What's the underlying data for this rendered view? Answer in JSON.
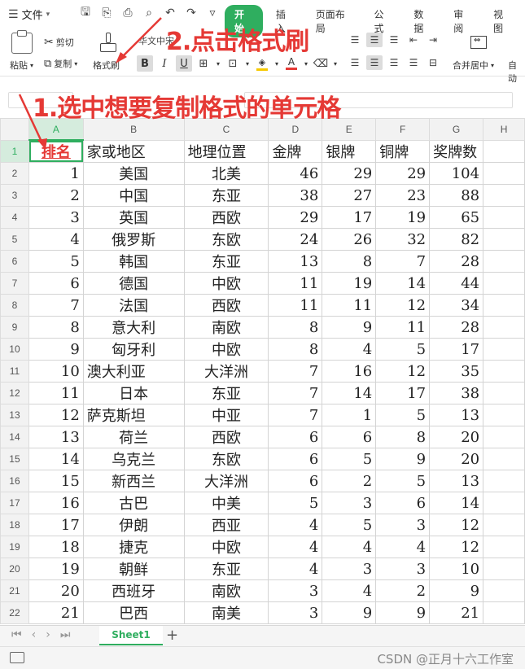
{
  "menubar": {
    "file_label": "文件",
    "tabs": [
      {
        "label": "开始",
        "active": true
      },
      {
        "label": "插入",
        "active": false
      },
      {
        "label": "页面布局",
        "active": false
      },
      {
        "label": "公式",
        "active": false
      },
      {
        "label": "数据",
        "active": false
      },
      {
        "label": "审阅",
        "active": false
      },
      {
        "label": "视图",
        "active": false
      }
    ]
  },
  "ribbon": {
    "paste_label": "粘贴",
    "cut_label": "剪切",
    "copy_label": "复制",
    "format_painter_label": "格式刷",
    "font_name": "华文中宋",
    "merge_label": "合并居中",
    "autowrap_label": "自动"
  },
  "annotations": {
    "step1": "1.选中想要复制格式的单元格",
    "step2": "2.点击格式刷"
  },
  "sheet": {
    "columns": [
      "A",
      "B",
      "C",
      "D",
      "E",
      "F",
      "G",
      "H"
    ],
    "selected_column": "A",
    "header_row": [
      "排名",
      "家或地区",
      "地理位置",
      "金牌",
      "银牌",
      "铜牌",
      "奖牌数"
    ],
    "rows": [
      [
        "1",
        "美国",
        "北美",
        "46",
        "29",
        "29",
        "104"
      ],
      [
        "2",
        "中国",
        "东亚",
        "38",
        "27",
        "23",
        "88"
      ],
      [
        "3",
        "英国",
        "西欧",
        "29",
        "17",
        "19",
        "65"
      ],
      [
        "4",
        "俄罗斯",
        "东欧",
        "24",
        "26",
        "32",
        "82"
      ],
      [
        "5",
        "韩国",
        "东亚",
        "13",
        "8",
        "7",
        "28"
      ],
      [
        "6",
        "德国",
        "中欧",
        "11",
        "19",
        "14",
        "44"
      ],
      [
        "7",
        "法国",
        "西欧",
        "11",
        "11",
        "12",
        "34"
      ],
      [
        "8",
        "意大利",
        "南欧",
        "8",
        "9",
        "11",
        "28"
      ],
      [
        "9",
        "匈牙利",
        "中欧",
        "8",
        "4",
        "5",
        "17"
      ],
      [
        "10",
        "澳大利亚",
        "大洋洲",
        "7",
        "16",
        "12",
        "35"
      ],
      [
        "11",
        "日本",
        "东亚",
        "7",
        "14",
        "17",
        "38"
      ],
      [
        "12",
        "萨克斯坦",
        "中亚",
        "7",
        "1",
        "5",
        "13"
      ],
      [
        "13",
        "荷兰",
        "西欧",
        "6",
        "6",
        "8",
        "20"
      ],
      [
        "14",
        "乌克兰",
        "东欧",
        "6",
        "5",
        "9",
        "20"
      ],
      [
        "15",
        "新西兰",
        "大洋洲",
        "6",
        "2",
        "5",
        "13"
      ],
      [
        "16",
        "古巴",
        "中美",
        "5",
        "3",
        "6",
        "14"
      ],
      [
        "17",
        "伊朗",
        "西亚",
        "4",
        "5",
        "3",
        "12"
      ],
      [
        "18",
        "捷克",
        "中欧",
        "4",
        "4",
        "4",
        "12"
      ],
      [
        "19",
        "朝鲜",
        "东亚",
        "4",
        "3",
        "3",
        "10"
      ],
      [
        "20",
        "西班牙",
        "南欧",
        "3",
        "4",
        "2",
        "9"
      ],
      [
        "21",
        "巴西",
        "南美",
        "3",
        "9",
        "9",
        "21"
      ]
    ]
  },
  "sheet_tabs": [
    {
      "label": "Sheet1",
      "active": true
    }
  ],
  "watermark": "CSDN @正月十六工作室",
  "colors": {
    "accent": "#2fae5f",
    "annotation": "#e53935"
  }
}
